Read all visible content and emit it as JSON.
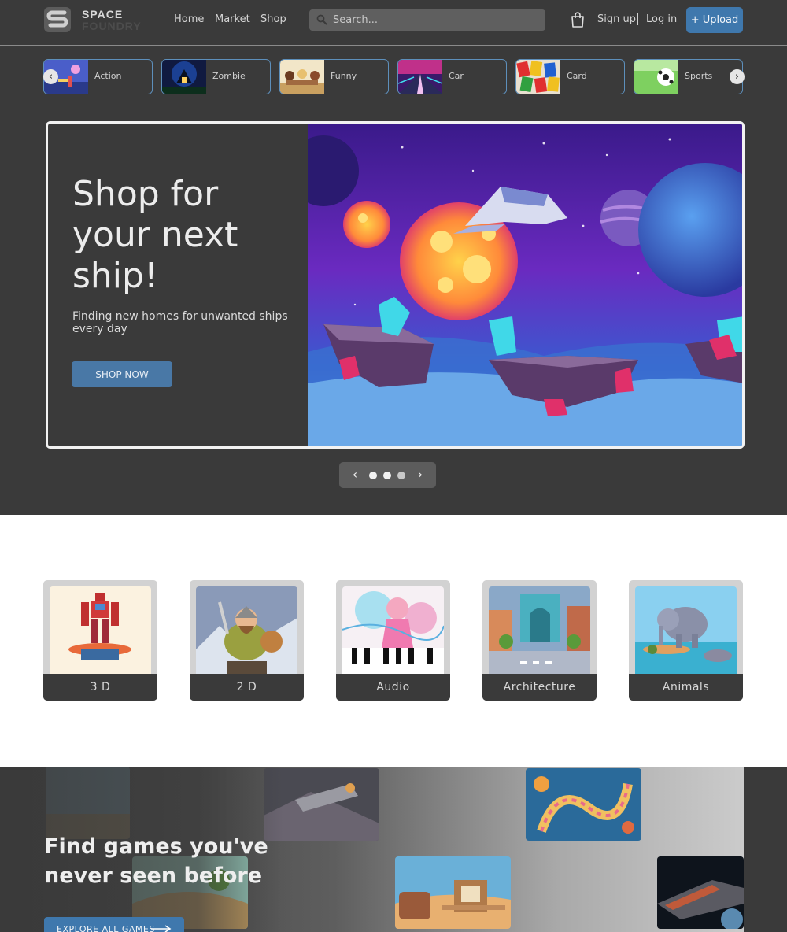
{
  "brand": {
    "line1": "SPACE",
    "line2": "FOUNDRY"
  },
  "nav": [
    {
      "label": "Home"
    },
    {
      "label": "Market"
    },
    {
      "label": "Shop"
    }
  ],
  "search": {
    "placeholder": "Search..."
  },
  "account": {
    "signup": "Sign up",
    "login": "Log in"
  },
  "upload": {
    "label": "+ Upload"
  },
  "categories": [
    {
      "label": "Action"
    },
    {
      "label": "Zombie"
    },
    {
      "label": "Funny"
    },
    {
      "label": "Car"
    },
    {
      "label": "Card"
    },
    {
      "label": "Sports"
    }
  ],
  "hero": {
    "title": "Shop for your next ship!",
    "subtitle": "Finding new homes for unwanted ships every day",
    "cta": "SHOP NOW",
    "slide_count": 3,
    "active_slide": 1
  },
  "asset_types": [
    {
      "label": "3 D"
    },
    {
      "label": "2 D"
    },
    {
      "label": "Audio"
    },
    {
      "label": "Architecture"
    },
    {
      "label": "Animals"
    }
  ],
  "promo": {
    "title": "Find games you've never seen before",
    "cta": "EXPLORE ALL GAMES"
  },
  "colors": {
    "accent": "#3f78ad",
    "background": "#3a3a3a",
    "chip_border": "#5d8fbb"
  }
}
